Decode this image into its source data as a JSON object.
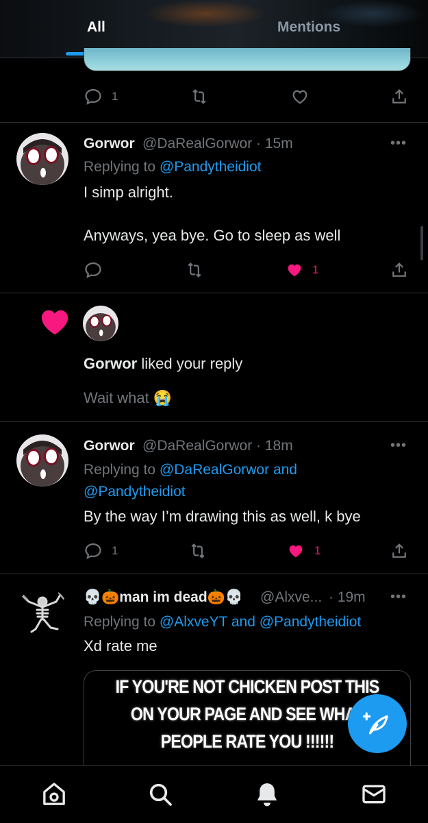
{
  "tabs": [
    {
      "label": "All",
      "active": true
    },
    {
      "label": "Mentions",
      "active": false
    }
  ],
  "top_post_actions": {
    "replies": "1"
  },
  "tweet1": {
    "name": "Gorwor",
    "handle_time": "@DaRealGorwor · 15m",
    "replying_prefix": "Replying to ",
    "replying_to": "@Pandytheidiot",
    "line1": "I simp alright.",
    "line2": "Anyways, yea bye. Go to sleep as well",
    "likes": "1"
  },
  "like_notification": {
    "name": "Gorwor",
    "action": " liked your reply",
    "quoted": "Wait what",
    "emoji": "😭"
  },
  "tweet2": {
    "name": "Gorwor",
    "handle_time": "@DaRealGorwor · 18m",
    "replying_prefix": "Replying to ",
    "replying_to_1": "@DaRealGorwor and",
    "replying_to_2": "@Pandytheidiot",
    "text": "By the way I’m drawing this as well, k bye",
    "replies": "1",
    "likes": "1"
  },
  "tweet3": {
    "name_prefix_emoji": "💀🎃",
    "name": "man im dead",
    "name_suffix_emoji": "🎃💀",
    "handle": "@Alxve...",
    "time": "· 19m",
    "replying_prefix": "Replying to ",
    "replying_to": "@AlxveYT and @Pandytheidiot",
    "text": "Xd rate me",
    "image_lines": [
      "IF YOU'RE NOT CHICKEN POST THIS",
      "ON YOUR PAGE AND SEE WHAT",
      "PEOPLE RATE YOU !!!!!!"
    ]
  },
  "more_glyph": "•••",
  "icons": {
    "reply": "reply-icon",
    "retweet": "retweet-icon",
    "like": "heart-icon",
    "share": "share-icon",
    "compose": "compose-feather-icon",
    "home": "home-icon",
    "search": "search-icon",
    "notifications": "bell-icon",
    "messages": "mail-icon"
  },
  "colors": {
    "accent": "#1d9bf0",
    "like": "#f91880",
    "muted": "#71767b",
    "text": "#e7e9ea"
  }
}
